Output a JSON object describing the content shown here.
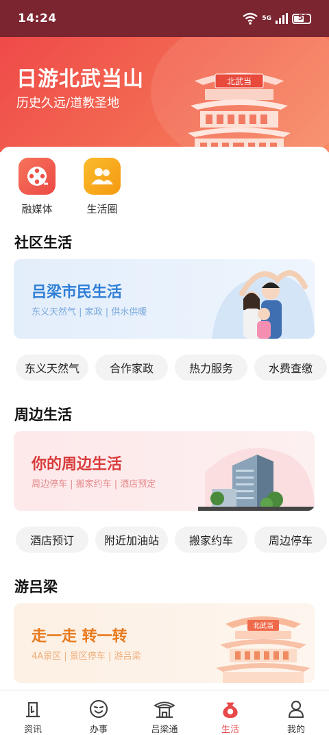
{
  "status_bar": {
    "time": "14:24",
    "network": "5G",
    "battery": "53"
  },
  "banner": {
    "title": "日游北武当山",
    "subtitle": "历史久远/道教圣地",
    "sign_text": "北武当"
  },
  "quick_actions": [
    {
      "label": "融媒体",
      "icon": "film-reel-icon",
      "color": "#f0584c"
    },
    {
      "label": "生活圈",
      "icon": "people-group-icon",
      "color": "#f8a81a"
    }
  ],
  "sections": [
    {
      "title": "社区生活",
      "card": {
        "title": "吕梁市民生活",
        "subtitle": "东义天然气 | 家政 | 供水供暖",
        "title_color": "#2f7fd6",
        "bg": "#e8f1fc"
      },
      "chips": [
        "东义天然气",
        "合作家政",
        "热力服务",
        "水费查缴"
      ]
    },
    {
      "title": "周边生活",
      "card": {
        "title": "你的周边生活",
        "subtitle": "周边停车 | 搬家约车 | 酒店预定",
        "title_color": "#d93b3b",
        "bg": "#fdecee"
      },
      "chips": [
        "酒店预订",
        "附近加油站",
        "搬家约车",
        "周边停车"
      ]
    },
    {
      "title": "游吕梁",
      "card": {
        "title": "走一走 转一转",
        "subtitle": "4A景区 | 景区停车 | 游吕梁",
        "title_color": "#e87a1e",
        "bg": "#fdf3ea",
        "sign_text": "北武当"
      }
    }
  ],
  "tabbar": {
    "active_color": "#e8484a",
    "items": [
      {
        "label": "资讯",
        "icon": "news-icon"
      },
      {
        "label": "办事",
        "icon": "service-face-icon"
      },
      {
        "label": "吕梁通",
        "icon": "pavilion-icon"
      },
      {
        "label": "生活",
        "icon": "life-bag-icon",
        "active": true
      },
      {
        "label": "我的",
        "icon": "user-icon"
      }
    ]
  }
}
